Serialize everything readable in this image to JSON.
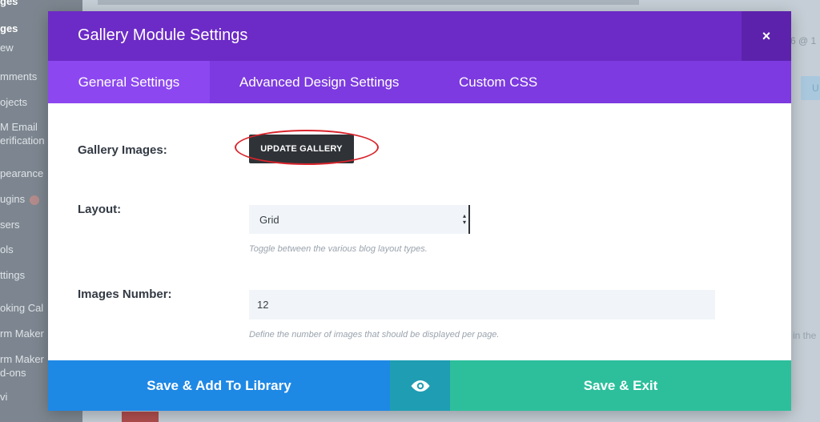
{
  "background": {
    "sidebar_items": [
      {
        "label": "ges",
        "active": true
      },
      {
        "label": "ges",
        "active": true
      },
      {
        "label": "ew",
        "active": false
      },
      {
        "label": "mments",
        "active": false
      },
      {
        "label": "ojects",
        "active": false
      },
      {
        "label": "M Email",
        "active": false
      },
      {
        "label": "erification",
        "active": false
      },
      {
        "label": "pearance",
        "active": false
      },
      {
        "label": "ugins",
        "active": false
      },
      {
        "label": "sers",
        "active": false
      },
      {
        "label": "ols",
        "active": false
      },
      {
        "label": "ttings",
        "active": false
      },
      {
        "label": "oking Cal",
        "active": false
      },
      {
        "label": "rm Maker",
        "active": false
      },
      {
        "label": "rm Maker",
        "active": false
      },
      {
        "label": "d-ons",
        "active": false
      },
      {
        "label": "vi",
        "active": false
      }
    ],
    "right_text": "6 @ 1",
    "right_button_label": "U",
    "right_text_2": "in the"
  },
  "modal": {
    "title": "Gallery Module Settings",
    "close_label": "×",
    "tabs": [
      {
        "label": "General Settings",
        "active": true
      },
      {
        "label": "Advanced Design Settings",
        "active": false
      },
      {
        "label": "Custom CSS",
        "active": false
      }
    ],
    "fields": {
      "gallery_images": {
        "label": "Gallery Images:",
        "button_label": "UPDATE GALLERY"
      },
      "layout": {
        "label": "Layout:",
        "selected": "Grid",
        "hint": "Toggle between the various blog layout types."
      },
      "images_number": {
        "label": "Images Number:",
        "value": "12",
        "hint": "Define the number of images that should be displayed per page."
      }
    },
    "footer": {
      "save_library_label": "Save & Add To Library",
      "preview_icon": "eye-icon",
      "save_exit_label": "Save & Exit"
    }
  },
  "colors": {
    "header": "#6c2bc6",
    "tabs": "#7c3ae0",
    "active_tab": "#8c47f0",
    "save_library": "#1e88e5",
    "preview": "#1f9db3",
    "save_exit": "#2dbf9c",
    "highlight": "#d9242c"
  }
}
